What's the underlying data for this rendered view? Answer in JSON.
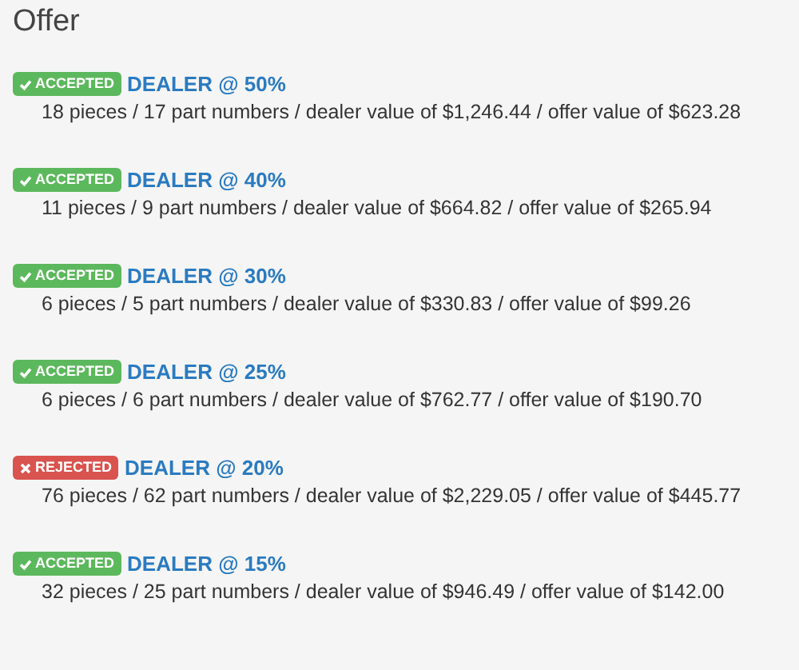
{
  "title": "Offer",
  "offers": [
    {
      "status": {
        "kind": "accepted",
        "label": "ACCEPTED"
      },
      "name": "DEALER @ 50%",
      "summary": "18 pieces / 17 part numbers / dealer value of $1,246.44 / offer value of $623.28"
    },
    {
      "status": {
        "kind": "accepted",
        "label": "ACCEPTED"
      },
      "name": "DEALER @ 40%",
      "summary": "11 pieces / 9 part numbers / dealer value of $664.82 / offer value of $265.94"
    },
    {
      "status": {
        "kind": "accepted",
        "label": "ACCEPTED"
      },
      "name": "DEALER @ 30%",
      "summary": "6 pieces / 5 part numbers / dealer value of $330.83 / offer value of $99.26"
    },
    {
      "status": {
        "kind": "accepted",
        "label": "ACCEPTED"
      },
      "name": "DEALER @ 25%",
      "summary": "6 pieces / 6 part numbers / dealer value of $762.77 / offer value of $190.70"
    },
    {
      "status": {
        "kind": "rejected",
        "label": "REJECTED"
      },
      "name": "DEALER @ 20%",
      "summary": "76 pieces / 62 part numbers / dealer value of $2,229.05 / offer value of $445.77"
    },
    {
      "status": {
        "kind": "accepted",
        "label": "ACCEPTED"
      },
      "name": "DEALER @ 15%",
      "summary": "32 pieces / 25 part numbers / dealer value of $946.49 / offer value of $142.00"
    }
  ]
}
